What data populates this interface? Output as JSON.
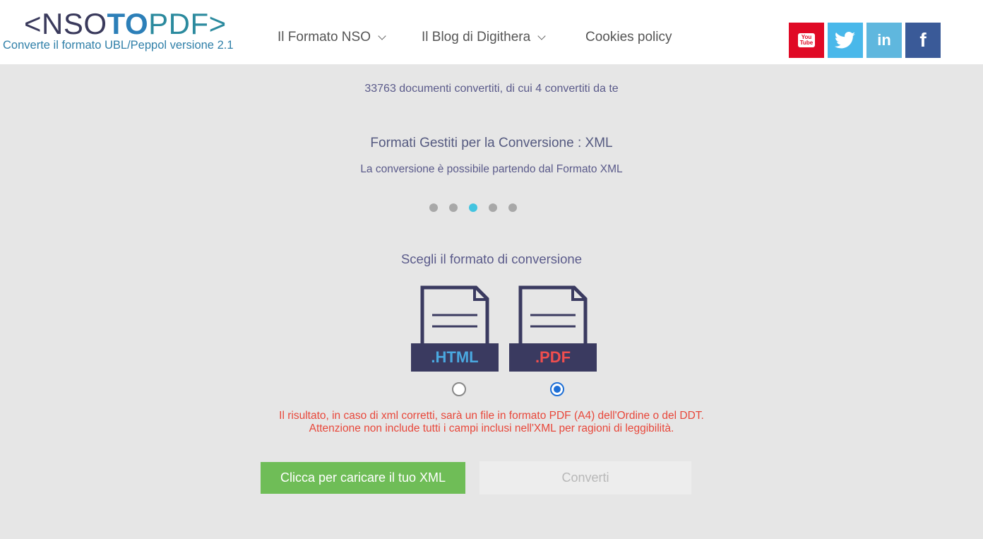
{
  "header": {
    "logo": {
      "prefix": "<NSO",
      "middle": "TO",
      "suffix": "PDF>",
      "tagline": "Converte il formato UBL/Peppol versione 2.1"
    },
    "nav": [
      {
        "label": "Il Formato NSO",
        "has_dropdown": true
      },
      {
        "label": "Il Blog di Digithera",
        "has_dropdown": true
      },
      {
        "label": "Cookies policy",
        "has_dropdown": false
      }
    ],
    "social": [
      {
        "name": "youtube",
        "icon": "youtube-icon",
        "label_top": "You",
        "label_bottom": "Tube",
        "color": "#e00925"
      },
      {
        "name": "twitter",
        "icon": "twitter-icon",
        "color": "#49b8ea"
      },
      {
        "name": "linkedin",
        "icon": "linkedin-icon",
        "label": "in",
        "color": "#5fb7de"
      },
      {
        "name": "facebook",
        "icon": "facebook-icon",
        "label": "f",
        "color": "#3a5a98"
      }
    ]
  },
  "main": {
    "counter": "33763 documenti convertiti, di cui 4 convertiti da te",
    "slide": {
      "title": "Formati Gestiti per la Conversione : XML",
      "description": "La conversione è possibile partendo dal Formato XML",
      "dots_total": 5,
      "active_dot": 3
    },
    "choose_label": "Scegli il formato di conversione",
    "formats": [
      {
        "label": ".HTML",
        "selected": false
      },
      {
        "label": ".PDF",
        "selected": true
      }
    ],
    "warning_line1": "Il risultato, in caso di xml corretti, sarà un file in formato PDF (A4) dell'Ordine o del DDT.",
    "warning_line2": "Attenzione non include tutti i campi inclusi nell'XML per ragioni di leggibilità.",
    "upload_label": "Clicca per caricare il tuo XML",
    "convert_label": "Converti"
  },
  "colors": {
    "accent_green": "#6fbd57",
    "warning_red": "#e8473a",
    "active_dot": "#43c4e0",
    "radio_selected": "#1e6fd6"
  }
}
